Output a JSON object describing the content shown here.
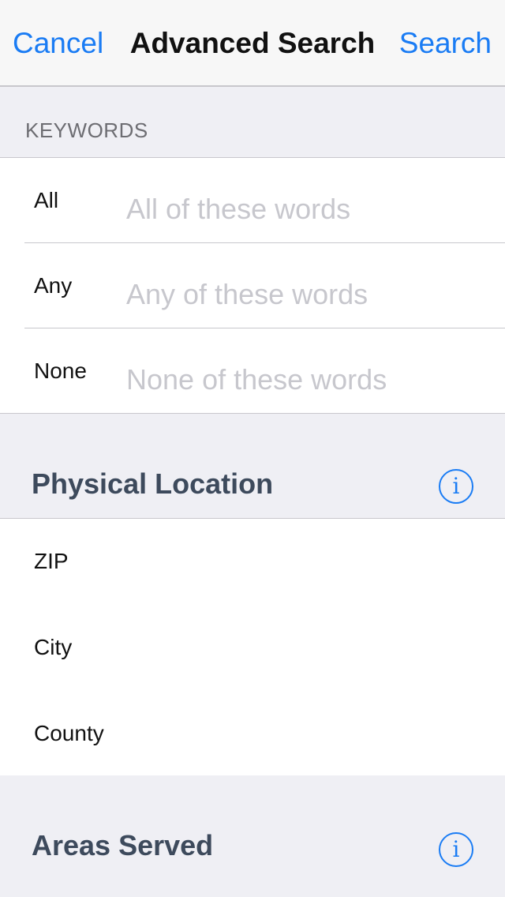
{
  "nav": {
    "cancel_label": "Cancel",
    "title": "Advanced Search",
    "search_label": "Search"
  },
  "keywords": {
    "header": "KEYWORDS",
    "rows": [
      {
        "label": "All",
        "placeholder": "All of these words",
        "value": ""
      },
      {
        "label": "Any",
        "placeholder": "Any of these words",
        "value": ""
      },
      {
        "label": "None",
        "placeholder": "None of these words",
        "value": ""
      }
    ]
  },
  "physical_location": {
    "header": "Physical Location",
    "info_icon": "info-icon",
    "info_glyph": "i",
    "rows": [
      {
        "label": "ZIP"
      },
      {
        "label": "City"
      },
      {
        "label": "County"
      }
    ]
  },
  "areas_served": {
    "header": "Areas Served",
    "info_icon": "info-icon",
    "info_glyph": "i"
  },
  "colors": {
    "accent": "#1a7cf4",
    "background": "#efeff4",
    "section_title": "#3d4a5c",
    "placeholder": "#c7c7cd"
  }
}
